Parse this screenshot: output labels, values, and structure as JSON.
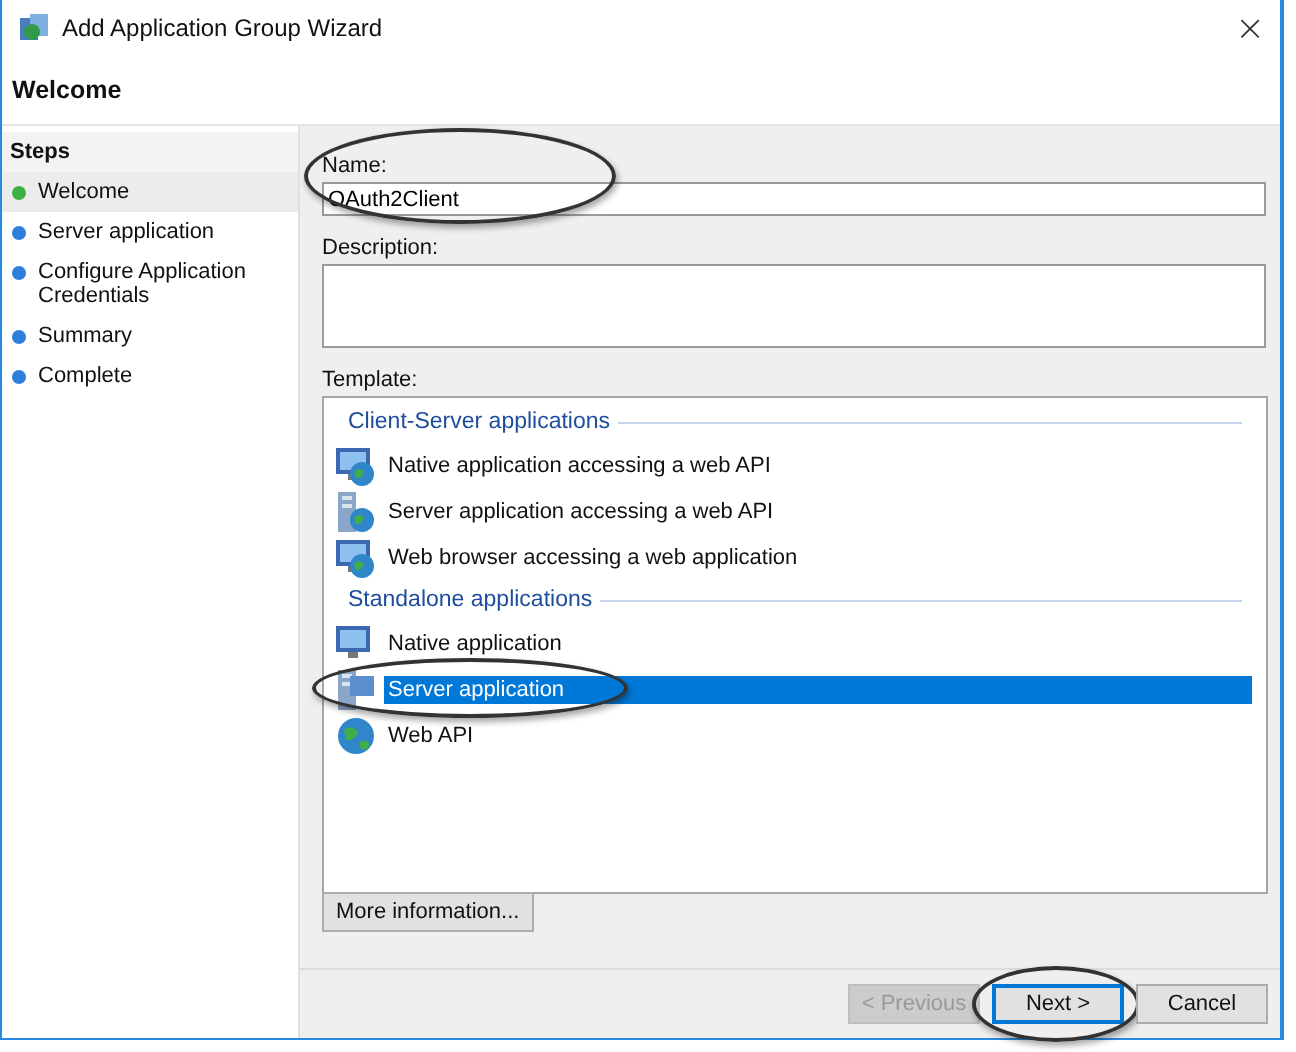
{
  "window": {
    "title": "Add Application Group Wizard",
    "close": "×"
  },
  "page_title": "Welcome",
  "steps": {
    "heading": "Steps",
    "items": [
      {
        "label": "Welcome",
        "selected": true,
        "color": "#3cb043"
      },
      {
        "label": "Server application",
        "selected": false,
        "color": "#2f7fd8"
      },
      {
        "label": "Configure Application Credentials",
        "selected": false,
        "color": "#2f7fd8"
      },
      {
        "label": "Summary",
        "selected": false,
        "color": "#2f7fd8"
      },
      {
        "label": "Complete",
        "selected": false,
        "color": "#2f7fd8"
      }
    ]
  },
  "name_field": {
    "label": "Name:",
    "value": "OAuth2Client",
    "circled": true
  },
  "description_field": {
    "label": "Description:"
  },
  "template": {
    "label": "Template:",
    "groups": [
      {
        "title": "Client-Server applications",
        "items": [
          {
            "label": "Native application accessing a web API",
            "kind": "native",
            "selected": false,
            "circled": false
          },
          {
            "label": "Server application accessing a web API",
            "kind": "server",
            "selected": false,
            "circled": false
          },
          {
            "label": "Web browser accessing a web application",
            "kind": "browser",
            "selected": false,
            "circled": false
          }
        ]
      },
      {
        "title": "Standalone applications",
        "items": [
          {
            "label": "Native application",
            "kind": "monitor",
            "selected": false,
            "circled": false
          },
          {
            "label": "Server application",
            "kind": "serverplain",
            "selected": true,
            "circled": true
          },
          {
            "label": "Web API",
            "kind": "globe",
            "selected": false,
            "circled": false
          }
        ]
      }
    ]
  },
  "more_info_button": "More information...",
  "buttons": [
    {
      "label": "< Previous",
      "disabled": true,
      "default": false,
      "circled": false
    },
    {
      "label": "Next >",
      "disabled": false,
      "default": true,
      "circled": true
    },
    {
      "label": "Cancel",
      "disabled": false,
      "default": false,
      "circled": false
    }
  ]
}
